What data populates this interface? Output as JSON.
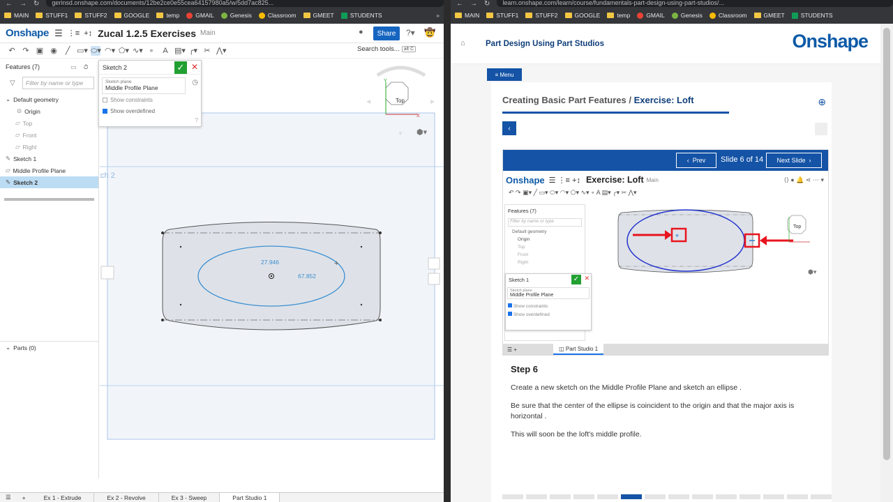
{
  "left_browser": {
    "url": "gerinsd.onshape.com/documents/12be2ce0e55cea64157980a5/w/5dd7ac825...",
    "bookmarks": [
      "MAIN",
      "STUFF1",
      "STUFF2",
      "GOOGLE",
      "temp",
      "GMAIL",
      "Genesis",
      "Classroom",
      "GMEET",
      "STUDENTS"
    ]
  },
  "right_browser": {
    "url": "learn.onshape.com/learn/course/fundamentals-part-design-using-part-studios/...",
    "bookmarks": [
      "MAIN",
      "STUFF1",
      "STUFF2",
      "GOOGLE",
      "temp",
      "GMAIL",
      "Genesis",
      "Classroom",
      "GMEET",
      "STUDENTS"
    ]
  },
  "onshape": {
    "logo": "Onshape",
    "title": "Zucal 1.2.5 Exercises",
    "branch": "Main",
    "share": "Share",
    "search_tools": "Search tools...",
    "search_kbd": "alt C",
    "features_header": "Features (7)",
    "filter_placeholder": "Filter by name or type",
    "features": [
      {
        "label": "Default geometry",
        "type": "group"
      },
      {
        "label": "Origin",
        "type": "sub"
      },
      {
        "label": "Top",
        "type": "dim"
      },
      {
        "label": "Front",
        "type": "dim"
      },
      {
        "label": "Right",
        "type": "dim"
      },
      {
        "label": "Sketch 1",
        "type": "item"
      },
      {
        "label": "Middle Profile Plane",
        "type": "item"
      },
      {
        "label": "Sketch 2",
        "type": "selected"
      }
    ],
    "parts": "Parts (0)",
    "dialog": {
      "title": "Sketch 2",
      "plane_label": "Sketch plane",
      "plane_value": "Middle Profile Plane",
      "show_constraints": "Show constraints",
      "show_overdefined": "Show overdefined"
    },
    "canvas_label": "tch 2",
    "dim_vertical": "27.946",
    "dim_horizontal": "67.852",
    "view_cube": "Top",
    "tabs": [
      "Ex 1 - Extrude",
      "Ex 2 - Revolve",
      "Ex 3 - Sweep",
      "Part Studio 1"
    ]
  },
  "learn": {
    "page_title": "Part Design Using Part Studios",
    "logo": "Onshape",
    "menu": "Menu",
    "crumb_course": "Creating Basic Part Features /",
    "crumb_exercise": "Exercise: Loft",
    "prev": "Prev",
    "slide_counter": "Slide 6 of 14",
    "next": "Next Slide",
    "shot_title": "Exercise: Loft",
    "shot_branch": "Main",
    "shot_features": "Features (7)",
    "shot_filter": "Filter by name or type",
    "shot_default": "Default geometry",
    "shot_origin": "Origin",
    "shot_top": "Top",
    "shot_front": "Front",
    "shot_right": "Right",
    "shot_sketch": "Sketch 1",
    "shot_plane_label": "Sketch plane",
    "shot_plane": "Middle Profile Plane",
    "shot_show_constraints": "Show constraints",
    "shot_show_overdefined": "Show overdefined",
    "shot_view": "Top",
    "shot_tab": "Part Studio 1",
    "step": "Step 6",
    "p1": "Create a new sketch on the Middle Profile Plane and sketch an ellipse .",
    "p2": "Be sure that the center of the ellipse is coincident to the origin and that the major axis is horizontal .",
    "p3": "This will soon be the loft's middle profile."
  }
}
